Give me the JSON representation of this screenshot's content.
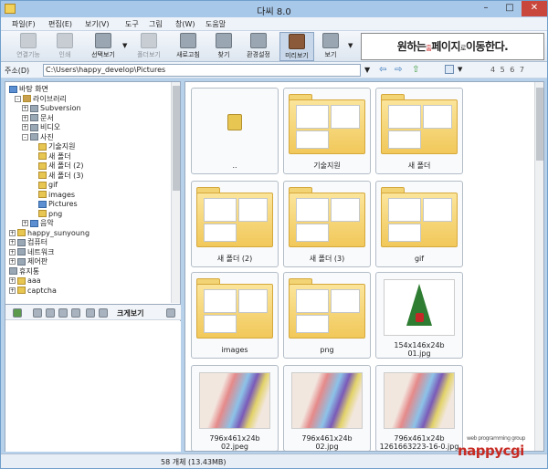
{
  "window": {
    "title": "다씨 8.0",
    "minimize": "–",
    "maximize": "□",
    "close": "✕"
  },
  "menu": [
    "파일(F)",
    "편집(E)",
    "보기(V)",
    "도구",
    "그림",
    "창(W)",
    "도움말"
  ],
  "toolbar": [
    {
      "label": "연결기능",
      "icon": "connect-icon",
      "enabled": false
    },
    {
      "label": "인쇄",
      "icon": "print-icon",
      "enabled": false
    },
    {
      "label": "선택보기",
      "icon": "select-view-icon",
      "enabled": true
    },
    {
      "label": "폴더보기",
      "icon": "folder-view-icon",
      "enabled": false
    },
    {
      "label": "새로고침",
      "icon": "refresh-icon",
      "enabled": true
    },
    {
      "label": "찾기",
      "icon": "find-icon",
      "enabled": true
    },
    {
      "label": "환경설정",
      "icon": "settings-icon",
      "enabled": true
    },
    {
      "label": "미리보기",
      "icon": "preview-icon",
      "enabled": true,
      "pressed": true
    },
    {
      "label": "보기",
      "icon": "view-icon",
      "enabled": true
    }
  ],
  "dropdown_arrow": "▼",
  "banner": {
    "part1": "원하는",
    "part2": "홈",
    "part3": "페이지",
    "part4": "로",
    "part5": "이동한다."
  },
  "address": {
    "label": "주소(D)",
    "value": "C:\\Users\\happy_develop\\Pictures",
    "back": "⇦",
    "forward": "⇨",
    "up": "⇧",
    "pages": "4 5 6 7"
  },
  "tree": [
    {
      "label": "바탕 화면",
      "exp": "",
      "icon": "blue"
    },
    {
      "label": "라이브러리",
      "exp": "-",
      "icon": "lib"
    },
    {
      "label": "Subversion",
      "exp": "+",
      "icon": "gray"
    },
    {
      "label": "문서",
      "exp": "+",
      "icon": "gray"
    },
    {
      "label": "비디오",
      "exp": "+",
      "icon": "gray"
    },
    {
      "label": "사진",
      "exp": "-",
      "icon": "gray"
    },
    {
      "label": "기술지원",
      "exp": "",
      "icon": ""
    },
    {
      "label": "새 폴더",
      "exp": "",
      "icon": ""
    },
    {
      "label": "새 폴더 (2)",
      "exp": "",
      "icon": ""
    },
    {
      "label": "새 폴더 (3)",
      "exp": "",
      "icon": ""
    },
    {
      "label": "gif",
      "exp": "",
      "icon": ""
    },
    {
      "label": "images",
      "exp": "",
      "icon": ""
    },
    {
      "label": "Pictures",
      "exp": "",
      "icon": "blue"
    },
    {
      "label": "png",
      "exp": "",
      "icon": ""
    },
    {
      "label": "음악",
      "exp": "+",
      "icon": "blue"
    },
    {
      "label": "happy_sunyoung",
      "exp": "+",
      "icon": ""
    },
    {
      "label": "컴퓨터",
      "exp": "+",
      "icon": "gray"
    },
    {
      "label": "네트워크",
      "exp": "+",
      "icon": "gray"
    },
    {
      "label": "제어판",
      "exp": "+",
      "icon": "gray"
    },
    {
      "label": "휴지통",
      "exp": "",
      "icon": "gray"
    },
    {
      "label": "aaa",
      "exp": "+",
      "icon": ""
    },
    {
      "label": "captcha",
      "exp": "+",
      "icon": ""
    }
  ],
  "preview": {
    "label": "크게보기"
  },
  "items": [
    {
      "label": "..",
      "type": "up"
    },
    {
      "label": "기술지원",
      "type": "folder"
    },
    {
      "label": "새 폴더",
      "type": "folder"
    },
    {
      "label": "새 폴더 (2)",
      "type": "folder"
    },
    {
      "label": "새 폴더 (3)",
      "type": "folder"
    },
    {
      "label": "gif",
      "type": "folder"
    },
    {
      "label": "images",
      "type": "folder"
    },
    {
      "label": "png",
      "type": "folder"
    },
    {
      "label": "154x146x24b\n01.jpg",
      "type": "xmas"
    },
    {
      "label": "796x461x24b\n02.jpeg",
      "type": "pencils"
    },
    {
      "label": "796x461x24b\n02.jpg",
      "type": "pencils"
    },
    {
      "label": "796x461x24b\n1261663223-16-0.jpg",
      "type": "pencils"
    }
  ],
  "status": "58 개체 (13.43MB)",
  "watermark": {
    "small": "web programming group",
    "big": "nappycgi"
  }
}
